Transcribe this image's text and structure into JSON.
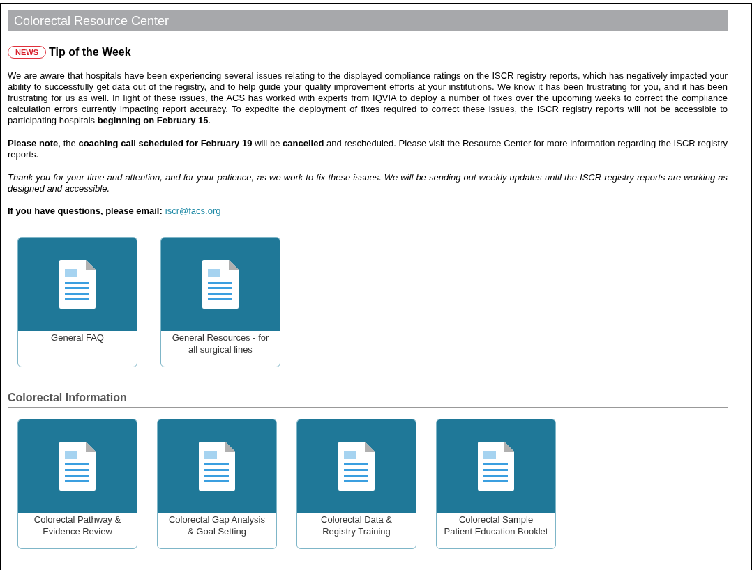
{
  "header": {
    "title": "Colorectal Resource Center"
  },
  "news": {
    "badge": "NEWS",
    "title": "Tip of the Week"
  },
  "paragraphs": [
    {
      "kind": "normal",
      "text": "We are aware that hospitals have been experiencing several issues relating to the displayed compliance ratings on the ISCR registry reports, which has negatively impacted your ability to successfully get data out of the registry, and to help guide your quality improvement efforts at your institutions. We know it has been frustrating for you, and it has been frustrating for us as well. In light of these issues, the ACS has worked with experts from IQVIA to deploy a number of fixes over the upcoming weeks to correct the compliance calculation errors currently impacting report accuracy. To expedite the deployment of fixes required to correct these issues, the ISCR registry reports will not be accessible to participating hospitals **beginning on February 15**."
    },
    {
      "kind": "normal",
      "text": "**Please note**, the **coaching call scheduled for February 19** will be **cancelled** and rescheduled. Please visit the Resource Center for more information regarding the ISCR registry reports."
    },
    {
      "kind": "italic",
      "text": "Thank you for your time and attention, and for your patience, as we work to fix these issues. We will be sending out weekly updates until the ISCR registry reports are working as designed and accessible."
    }
  ],
  "contact": {
    "prompt": "If you have questions, please email:",
    "link": "iscr@facs.org"
  },
  "general_tiles": [
    {
      "label": "General FAQ"
    },
    {
      "label": "General Resources - for all surgical lines"
    }
  ],
  "colorectal_section": {
    "title": "Colorectal Information",
    "tiles": [
      {
        "label": "Colorectal Pathway & Evidence Review"
      },
      {
        "label": "Colorectal Gap Analysis & Goal Setting"
      },
      {
        "label": "Colorectal Data & Registry Training"
      },
      {
        "label": "Colorectal Sample Patient Education Booklet"
      }
    ]
  }
}
